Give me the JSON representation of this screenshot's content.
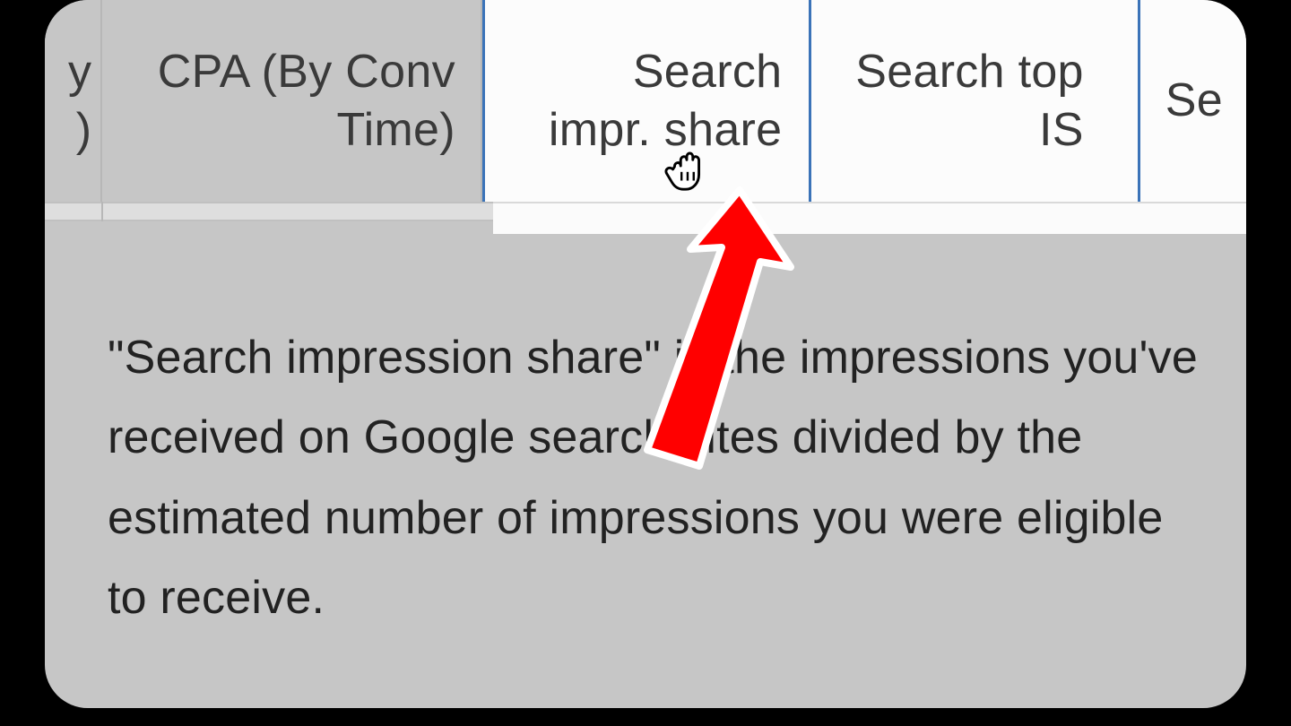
{
  "columns": {
    "partial_left": "y\n)",
    "cpa": "CPA (By Conv\nTime)",
    "impr_share": "Search\nimpr. share",
    "top_is": "Search top\nIS",
    "partial_right": "Se"
  },
  "description": "\"Search impression share\" is the impressions you've received on Google search sites divided by the estimated number of impressions you were eligible to receive.",
  "accent_blue": "#3b73b8",
  "arrow_color": "#ff0000"
}
